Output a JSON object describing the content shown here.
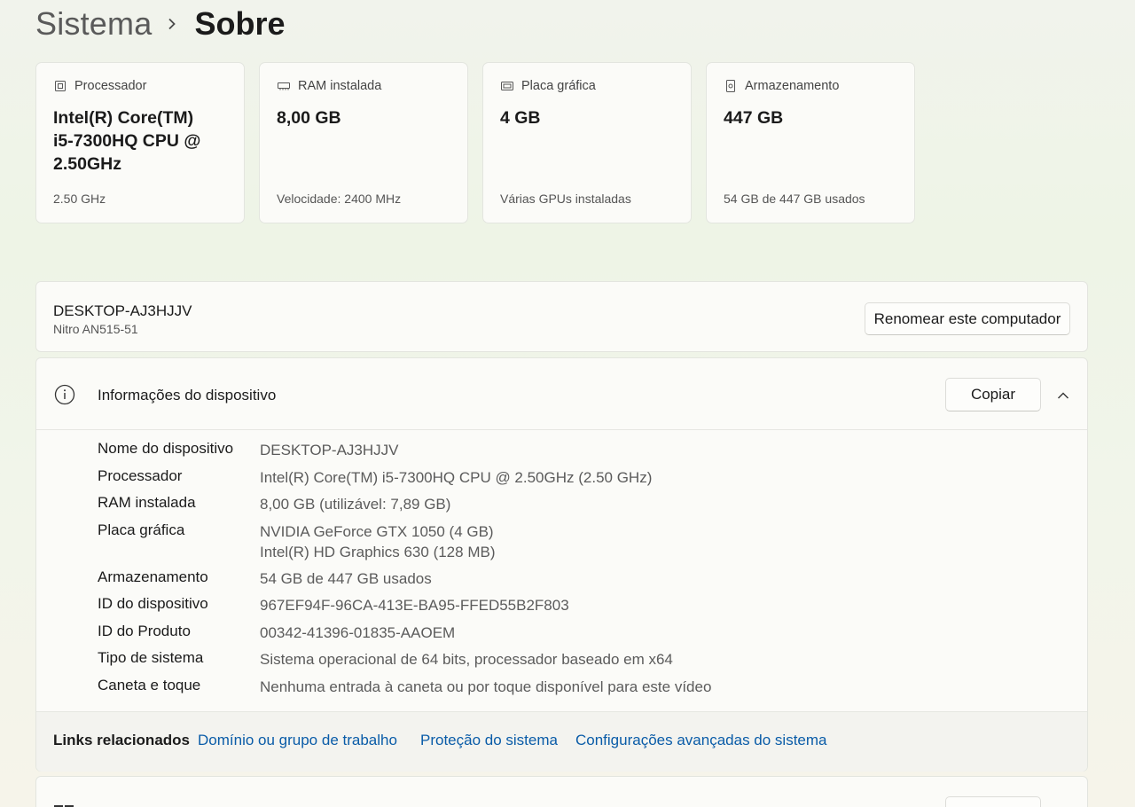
{
  "breadcrumb": {
    "parent": "Sistema",
    "current": "Sobre"
  },
  "cards": [
    {
      "icon": "processor-icon",
      "title": "Processador",
      "value": "Intel(R) Core(TM) i5-7300HQ CPU @ 2.50GHz",
      "sub": "2.50 GHz"
    },
    {
      "icon": "ram-icon",
      "title": "RAM instalada",
      "value": "8,00 GB",
      "sub": "Velocidade: 2400 MHz"
    },
    {
      "icon": "gpu-icon",
      "title": "Placa gráfica",
      "value": "4 GB",
      "sub": "Várias GPUs instaladas"
    },
    {
      "icon": "storage-icon",
      "title": "Armazenamento",
      "value": "447 GB",
      "sub": "54 GB de 447 GB usados"
    }
  ],
  "device": {
    "name": "DESKTOP-AJ3HJJV",
    "model": "Nitro AN515-51",
    "rename_label": "Renomear este computador"
  },
  "info": {
    "title": "Informações do dispositivo",
    "copy_label": "Copiar",
    "specs": [
      {
        "label": "Nome do dispositivo",
        "value": "DESKTOP-AJ3HJJV"
      },
      {
        "label": "Processador",
        "value": "Intel(R) Core(TM) i5-7300HQ CPU @ 2.50GHz (2.50 GHz)"
      },
      {
        "label": "RAM instalada",
        "value": "8,00 GB (utilizável: 7,89 GB)"
      },
      {
        "label": "Placa gráfica",
        "value": "NVIDIA GeForce GTX 1050 (4 GB)",
        "value2": "Intel(R) HD Graphics 630 (128 MB)"
      },
      {
        "label": "Armazenamento",
        "value": "54 GB de 447 GB usados"
      },
      {
        "label": "ID do dispositivo",
        "value": "967EF94F-96CA-413E-BA95-FFED55B2F803"
      },
      {
        "label": "ID do Produto",
        "value": "00342-41396-01835-AAOEM"
      },
      {
        "label": "Tipo de sistema",
        "value": "Sistema operacional de 64 bits, processador baseado em x64"
      },
      {
        "label": "Caneta e toque",
        "value": "Nenhuma entrada à caneta ou por toque disponível para este vídeo"
      }
    ]
  },
  "related": {
    "label": "Links relacionados",
    "links": [
      "Domínio ou grupo de trabalho",
      "Proteção do sistema",
      "Configurações avançadas do sistema"
    ]
  }
}
